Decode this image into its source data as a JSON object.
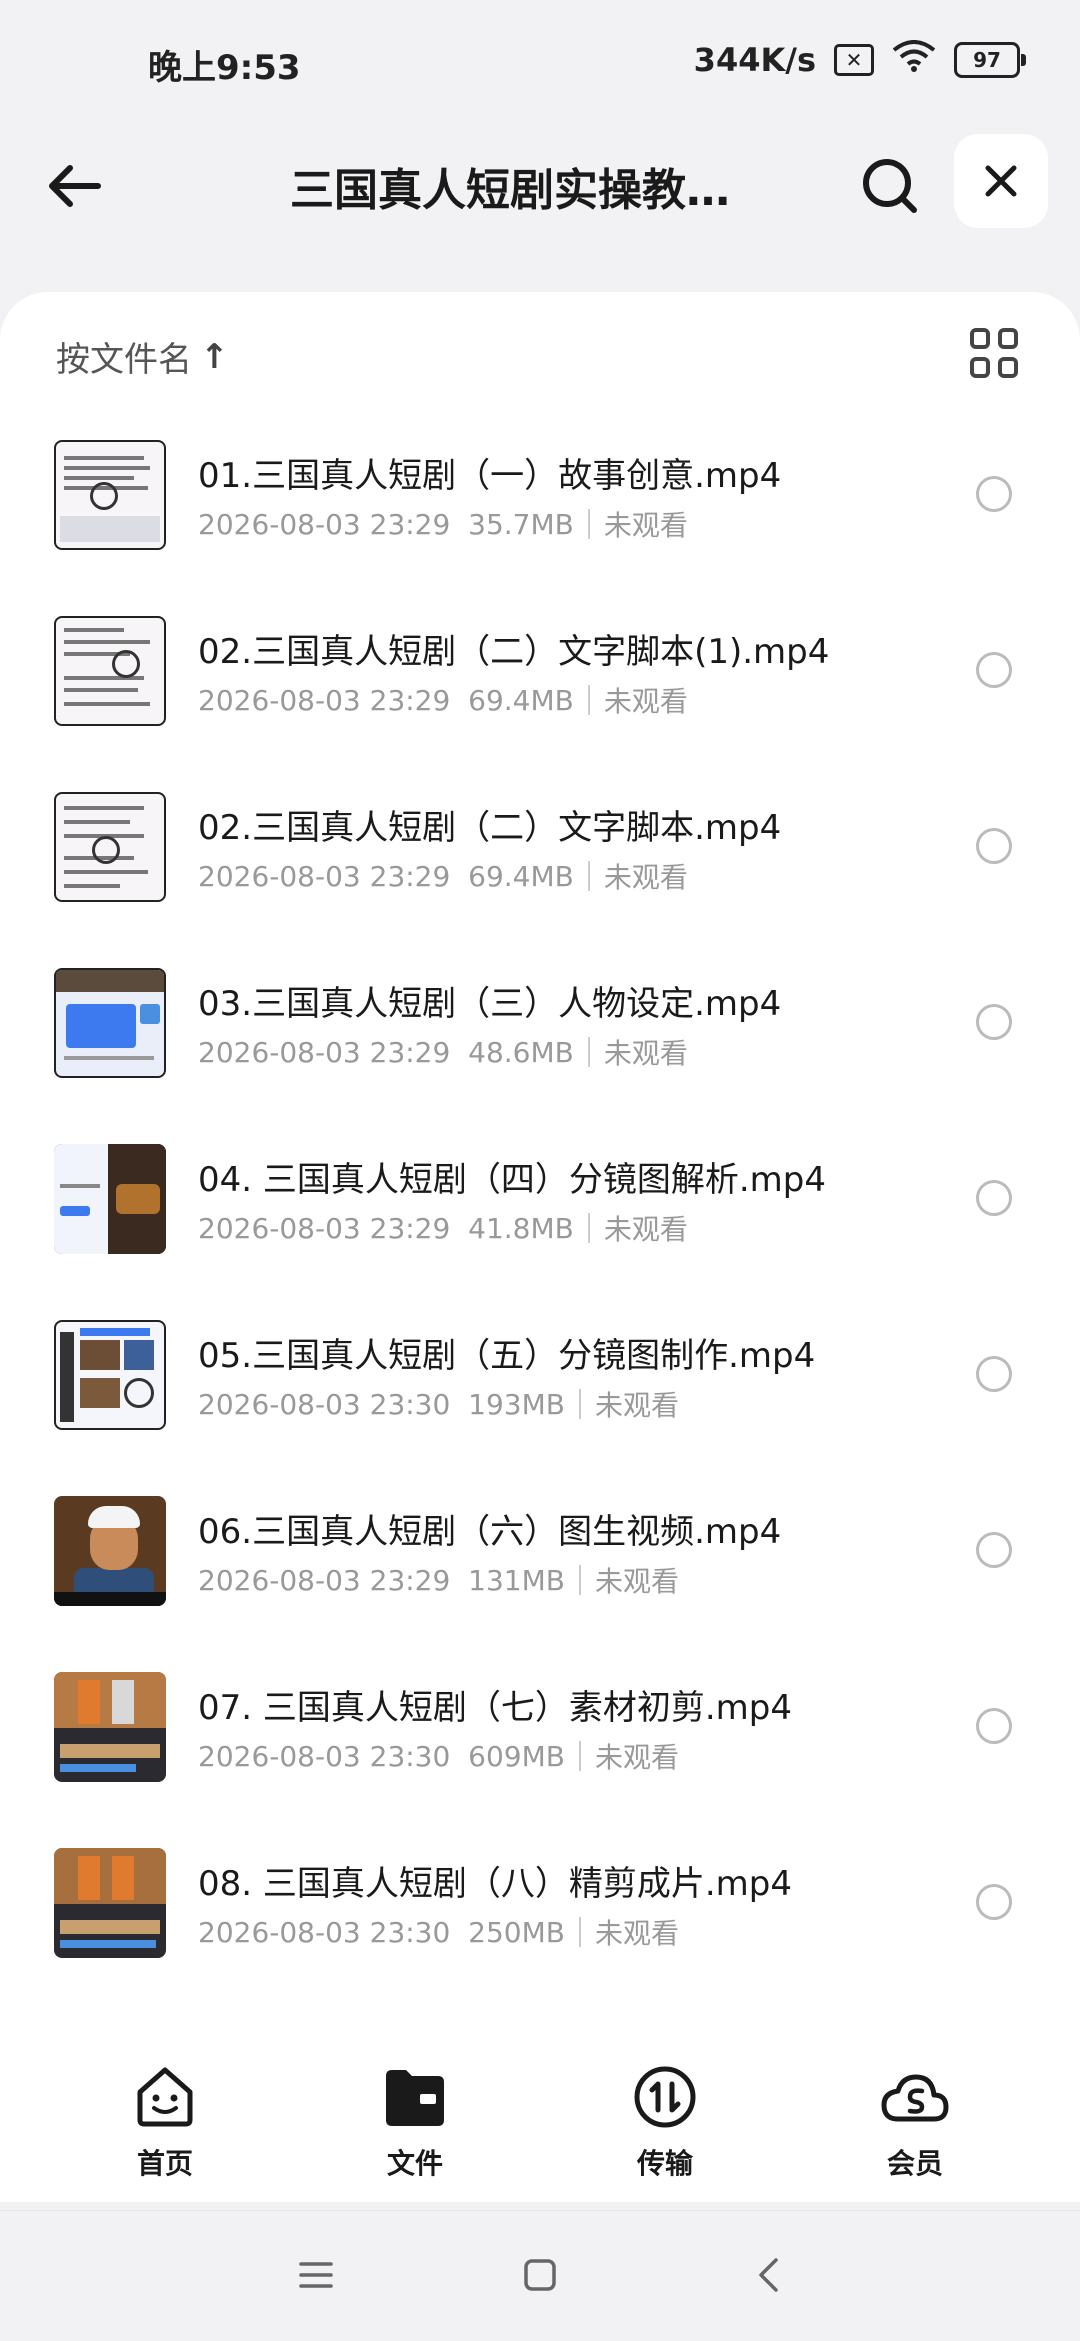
{
  "status_bar": {
    "time": "晚上9:53",
    "network_speed": "344K/s",
    "battery": "97"
  },
  "header": {
    "title": "三国真人短剧实操教学...",
    "back_icon": "arrow-left-icon",
    "search_icon": "search-icon",
    "close_icon": "close-icon"
  },
  "toolbar": {
    "sort_label": "按文件名",
    "sort_arrow": "↑",
    "view_icon": "grid-view-icon"
  },
  "files": [
    {
      "name": "01.三国真人短剧（一）故事创意.mp4",
      "date": "2026-08-03 23:29",
      "size": "35.7MB",
      "status": "未观看"
    },
    {
      "name": "02.三国真人短剧（二）文字脚本(1).mp4",
      "date": "2026-08-03 23:29",
      "size": "69.4MB",
      "status": "未观看"
    },
    {
      "name": "02.三国真人短剧（二）文字脚本.mp4",
      "date": "2026-08-03 23:29",
      "size": "69.4MB",
      "status": "未观看"
    },
    {
      "name": "03.三国真人短剧（三）人物设定.mp4",
      "date": "2026-08-03 23:29",
      "size": "48.6MB",
      "status": "未观看"
    },
    {
      "name": "04. 三国真人短剧（四）分镜图解析.mp4",
      "date": "2026-08-03 23:29",
      "size": "41.8MB",
      "status": "未观看"
    },
    {
      "name": "05.三国真人短剧（五）分镜图制作.mp4",
      "date": "2026-08-03 23:30",
      "size": "193MB",
      "status": "未观看"
    },
    {
      "name": "06.三国真人短剧（六）图生视频.mp4",
      "date": "2026-08-03 23:29",
      "size": "131MB",
      "status": "未观看"
    },
    {
      "name": "07. 三国真人短剧（七）素材初剪.mp4",
      "date": "2026-08-03 23:30",
      "size": "609MB",
      "status": "未观看"
    },
    {
      "name": "08. 三国真人短剧（八）精剪成片.mp4",
      "date": "2026-08-03 23:30",
      "size": "250MB",
      "status": "未观看"
    }
  ],
  "bottom_nav": [
    {
      "label": "首页",
      "icon": "home-face-icon"
    },
    {
      "label": "文件",
      "icon": "folder-icon"
    },
    {
      "label": "传输",
      "icon": "transfer-icon"
    },
    {
      "label": "会员",
      "icon": "vip-cloud-icon"
    }
  ],
  "system_nav": {
    "menu_icon": "menu-icon",
    "home_icon": "home-square-icon",
    "back_icon": "back-chevron-icon"
  }
}
